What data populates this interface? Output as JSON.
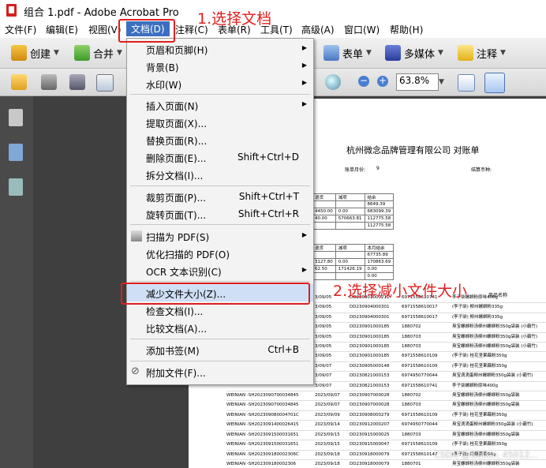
{
  "window": {
    "title": "组合 1.pdf - Adobe Acrobat Pro"
  },
  "menubar": [
    "文件(F)",
    "编辑(E)",
    "视图(V)",
    "文档(D)",
    "注释(C)",
    "表单(R)",
    "工具(T)",
    "高级(A)",
    "窗口(W)",
    "帮助(H)"
  ],
  "toolbar1": {
    "create": "创建",
    "combine": "合并",
    "forms": "表单",
    "multimedia": "多媒体",
    "comment": "注释"
  },
  "toolbar2": {
    "zoom": "63.8%"
  },
  "menu": {
    "items": [
      {
        "label": "页眉和页脚(H)",
        "shortcut": "",
        "submenu": true
      },
      {
        "label": "背景(B)",
        "shortcut": "",
        "submenu": true
      },
      {
        "label": "水印(W)",
        "shortcut": "",
        "submenu": true
      },
      {
        "label": "插入页面(N)",
        "shortcut": "",
        "submenu": true
      },
      {
        "label": "提取页面(X)...",
        "shortcut": "",
        "submenu": false
      },
      {
        "label": "替换页面(R)...",
        "shortcut": "",
        "submenu": false
      },
      {
        "label": "删除页面(E)...",
        "shortcut": "Shift+Ctrl+D",
        "submenu": false
      },
      {
        "label": "拆分文档(I)...",
        "shortcut": "",
        "submenu": false
      },
      {
        "label": "裁剪页面(P)...",
        "shortcut": "Shift+Ctrl+T",
        "submenu": false
      },
      {
        "label": "旋转页面(T)...",
        "shortcut": "Shift+Ctrl+R",
        "submenu": false
      },
      {
        "label": "扫描为 PDF(S)",
        "shortcut": "",
        "submenu": true
      },
      {
        "label": "优化扫描的 PDF(O)",
        "shortcut": "",
        "submenu": false
      },
      {
        "label": "OCR 文本识别(C)",
        "shortcut": "",
        "submenu": true
      },
      {
        "label": "减少文件大小(Z)...",
        "shortcut": "",
        "submenu": false
      },
      {
        "label": "检查文档(I)...",
        "shortcut": "",
        "submenu": false
      },
      {
        "label": "比较文档(A)...",
        "shortcut": "",
        "submenu": false
      },
      {
        "label": "添加书签(M)",
        "shortcut": "Ctrl+B",
        "submenu": false
      },
      {
        "label": "附加文件(F)...",
        "shortcut": "",
        "submenu": false
      }
    ]
  },
  "annotations": {
    "step1": "1.选择文档",
    "step2": "2.选择减小文件大小"
  },
  "document": {
    "title": "杭州微念品牌管理有限公司 对账单",
    "meta": [
      "账单月份:",
      "9",
      "结算币种:"
    ],
    "table1": [
      [
        "退货",
        "减项",
        "结余"
      ],
      [
        "",
        "",
        "8649.39"
      ],
      [
        "4450.00",
        "0.00",
        "683099.39"
      ],
      [
        "40.00",
        "570663.81",
        "112775.58"
      ],
      [
        "",
        "",
        "112775.58"
      ]
    ],
    "table2": [
      [
        "退货",
        "减项",
        "本月结余"
      ],
      [
        "",
        "",
        "67735.89"
      ],
      [
        "3127.80",
        "0.00",
        "170863.69"
      ],
      [
        "62.50",
        "171426.19",
        "0.00"
      ],
      [
        "",
        "",
        "0.00"
      ]
    ],
    "rows": [
      [
        "",
        "3/09/05",
        "DD230901000211",
        "6971558610741",
        "李子柒螺蛳粉原味400g"
      ],
      [
        "",
        "3/09/05",
        "DD230904000301",
        "6971558610017",
        "(李子柒) 柳州螺蛳粉335g"
      ],
      [
        "",
        "3/09/05",
        "DD230904000301",
        "6971558610017",
        "(李子柒) 柳州螺蛳粉335g"
      ],
      [
        "",
        "3/09/05",
        "DD230901000185",
        "1880702",
        "臭宝螺蛳粉汤柳州螺蛳粉350g袋装 (小霸竹)"
      ],
      [
        "",
        "3/09/05",
        "DD230901000185",
        "1880703",
        "臭宝螺蛳粉汤柳州螺蛳粉350g袋装 (小霸竹)"
      ],
      [
        "",
        "3/09/05",
        "DD230901000185",
        "1880703",
        "臭宝螺蛳粉汤柳州螺蛳粉350g袋装 (小霸竹)"
      ],
      [
        "",
        "3/09/05",
        "DD230901000185",
        "6971558610109",
        "(李子柒) 桂花坚果藕粉350g"
      ],
      [
        "",
        "3/09/07",
        "DD230905000148",
        "6971558610109",
        "(李子柒) 桂花坚果藕粉350g"
      ],
      [
        "",
        "3/09/07",
        "DD230821000153",
        "6974950770044",
        "臭宝滴滴蛋柳州螺蛳粉350g袋装 (小霸竹)"
      ],
      [
        "",
        "3/09/07",
        "DD230821000153",
        "6971558610741",
        "李子柒螺蛳粉原味400g"
      ],
      [
        "WEINIAN -SH2023090700034845",
        "2023/09/07",
        "DD230907000028",
        "1880702",
        "臭宝螺蛳粉汤柳州螺蛳粉350g袋装"
      ],
      [
        "WEINIAN -SH2023090700034845",
        "2023/09/07",
        "DD230907000028",
        "1880703",
        "臭宝螺蛳粉汤柳州螺蛳粉350g袋装"
      ],
      [
        "WEINIAN -SH202309080004701C",
        "2023/09/09",
        "DD230908000279",
        "6971558610109",
        "(李子柒) 桂花坚果藕粉350g"
      ],
      [
        "WEINIAN -SH2023091400026415",
        "2023/09/14",
        "DD230912000207",
        "6974950770044",
        "臭宝滴滴蛋柳州螺蛳粉350g袋装 (小霸竹)"
      ],
      [
        "WEINIAN -SH2023091500031651",
        "2023/09/15",
        "DD230915000025",
        "1880703",
        "臭宝螺蛳粉汤柳州螺蛳粉350g袋装"
      ],
      [
        "WEINIAN -SH2023091500031651",
        "2023/09/15",
        "DD230915000047",
        "6971558610109",
        "(李子柒) 桂花坚果藕粉350g"
      ],
      [
        "WEINIAN -SH202309180002306C",
        "2023/09/18",
        "DD230918000079",
        "6971558610147",
        "(李子柒) 红糖姜茶84g"
      ],
      [
        "WEINIAN -SH202309180002306",
        "2023/09/18",
        "DD230918000079",
        "1880701",
        "臭宝螺蛳粉汤柳州螺蛳粉350g袋装"
      ],
      [
        "WEINIAN -SH202309180002306",
        "2023/09/18",
        "DD230918000079",
        "1880703",
        "臭宝螺蛳粉汤柳州螺蛳粉350g袋装"
      ]
    ],
    "product_header": "商品名称"
  },
  "watermark": "CSDN @weixin_45012..."
}
